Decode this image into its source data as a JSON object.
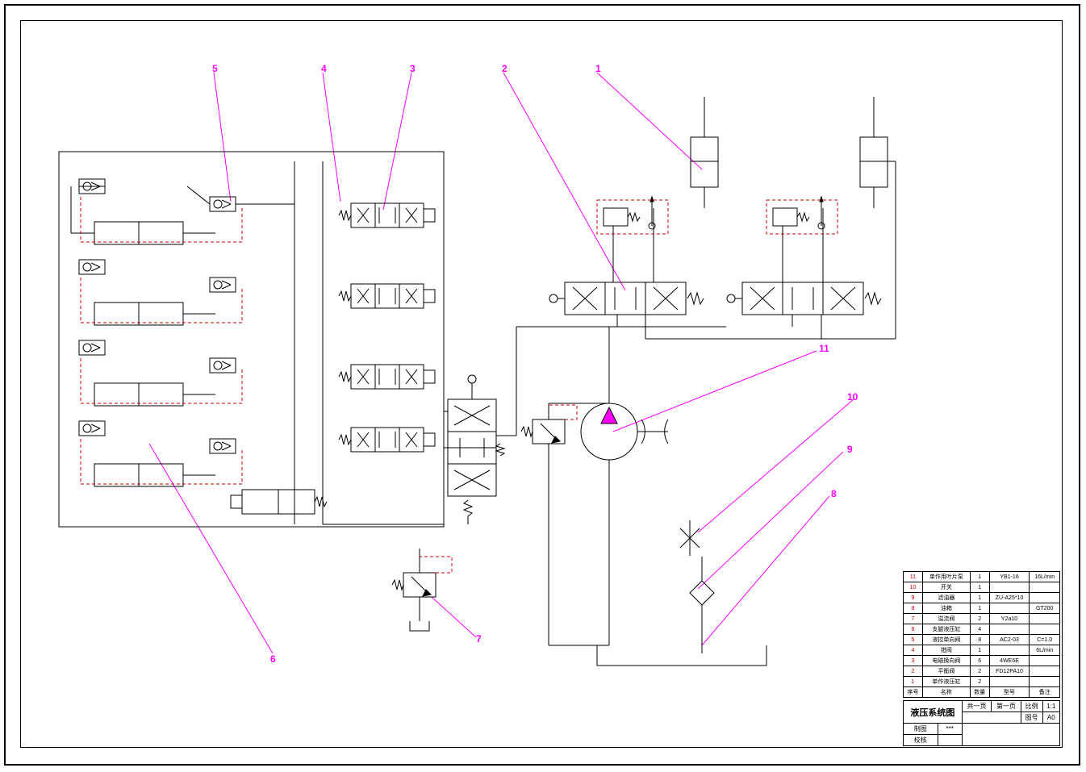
{
  "callouts": {
    "c1": "1",
    "c2": "2",
    "c3": "3",
    "c4": "4",
    "c5": "5",
    "c6": "6",
    "c7": "7",
    "c8": "8",
    "c9": "9",
    "c10": "10",
    "c11": "11"
  },
  "bom": {
    "header": {
      "no": "序号",
      "name": "名称",
      "qty": "数量",
      "model": "型号",
      "note": "备注"
    },
    "rows": [
      {
        "no": "11",
        "name": "单作用叶片泵",
        "qty": "1",
        "model": "YB1-16",
        "note": "16L/min"
      },
      {
        "no": "10",
        "name": "开关",
        "qty": "1",
        "model": "",
        "note": ""
      },
      {
        "no": "9",
        "name": "滤油器",
        "qty": "1",
        "model": "ZU-A25*10",
        "note": ""
      },
      {
        "no": "8",
        "name": "油箱",
        "qty": "1",
        "model": "",
        "note": "GT200"
      },
      {
        "no": "7",
        "name": "溢流阀",
        "qty": "2",
        "model": "Y2a10",
        "note": ""
      },
      {
        "no": "6",
        "name": "支腿液压缸",
        "qty": "4",
        "model": "",
        "note": ""
      },
      {
        "no": "5",
        "name": "液控单向阀",
        "qty": "8",
        "model": "AC2-03",
        "note": "C=1.0"
      },
      {
        "no": "4",
        "name": "钳阀",
        "qty": "1",
        "model": "",
        "note": "6L/min"
      },
      {
        "no": "3",
        "name": "电磁换向阀",
        "qty": "6",
        "model": "4WE6E",
        "note": ""
      },
      {
        "no": "2",
        "name": "平衡阀",
        "qty": "2",
        "model": "FD12PA10",
        "note": ""
      },
      {
        "no": "1",
        "name": "单作液压缸",
        "qty": "2",
        "model": "",
        "note": ""
      }
    ]
  },
  "titleblock": {
    "title": "液压系统图",
    "sheet1": "共一页",
    "sheet2": "第一页",
    "scale_label": "比例",
    "scale": "1:1",
    "drawing_label": "图号",
    "drawing": "A0",
    "drawn": "制图",
    "check": "校核",
    "drawn_by": "***"
  }
}
